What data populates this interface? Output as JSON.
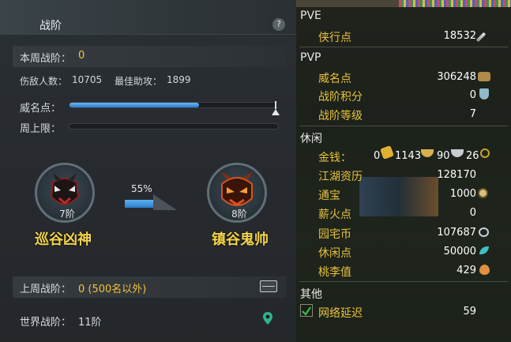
{
  "left_panel": {
    "title": "战阶",
    "help": "?",
    "week_rank_label": "本周战阶：",
    "week_rank_value": "0",
    "kills_label": "伤敌人数：",
    "kills_value": "10705",
    "assist_label": "最佳助攻：",
    "assist_value": "1899",
    "prestige_label": "威名点：",
    "prestige_progress": 0.62,
    "weekly_cap_label": "周上限：",
    "current_rank": {
      "name": "巡谷凶神",
      "level": "7阶"
    },
    "next_rank": {
      "name": "镇谷鬼帅",
      "level": "8阶"
    },
    "progress_percent": "55%",
    "last_week_label": "上周战阶：",
    "last_week_value": "0 (500名以外)",
    "world_label": "世界战阶：",
    "world_value": "11阶",
    "colors": {
      "accent_yellow": "#f2c33a",
      "bar_blue": "#3a8fdc"
    }
  },
  "right_panel": {
    "sections": {
      "pve": "PVE",
      "pvp": "PVP",
      "leisure": "休闲",
      "other": "其他"
    },
    "pve": [
      {
        "label": "侠行点",
        "value": "18532",
        "icon": "sword-icon"
      }
    ],
    "pvp": [
      {
        "label": "威名点",
        "value": "306248",
        "icon": "mask-icon"
      },
      {
        "label": "战阶积分",
        "value": "0",
        "icon": "trophy-icon"
      },
      {
        "label": "战阶等级",
        "value": "7"
      }
    ],
    "money": {
      "label": "金钱：",
      "gold": "0",
      "silver": "1143",
      "copper": "90",
      "wen": "26"
    },
    "leisure": [
      {
        "label": "江湖资历",
        "value": "128170"
      },
      {
        "label": "通宝",
        "value": "1000",
        "icon": "coin-icon"
      },
      {
        "label": "薪火点",
        "value": "0"
      },
      {
        "label": "园宅币",
        "value": "107687",
        "icon": "house-coin-icon"
      },
      {
        "label": "休闲点",
        "value": "50000",
        "icon": "leaf-icon"
      },
      {
        "label": "桃李值",
        "value": "429",
        "icon": "peach-icon"
      }
    ],
    "other": [
      {
        "label": "网络延迟",
        "value": "59",
        "checked": true
      }
    ]
  }
}
